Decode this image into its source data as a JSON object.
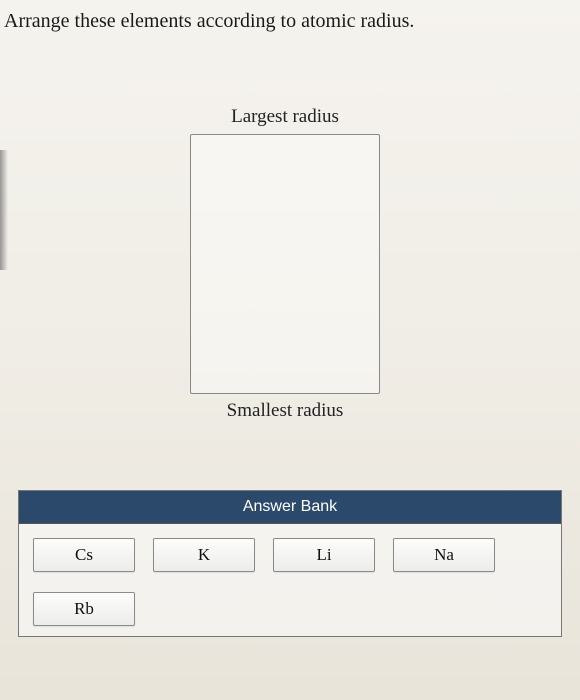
{
  "prompt": "Arrange these elements according to atomic radius.",
  "labels": {
    "top": "Largest radius",
    "bottom": "Smallest radius"
  },
  "answer_bank": {
    "title": "Answer Bank",
    "tiles": [
      "Cs",
      "K",
      "Li",
      "Na",
      "Rb"
    ]
  }
}
